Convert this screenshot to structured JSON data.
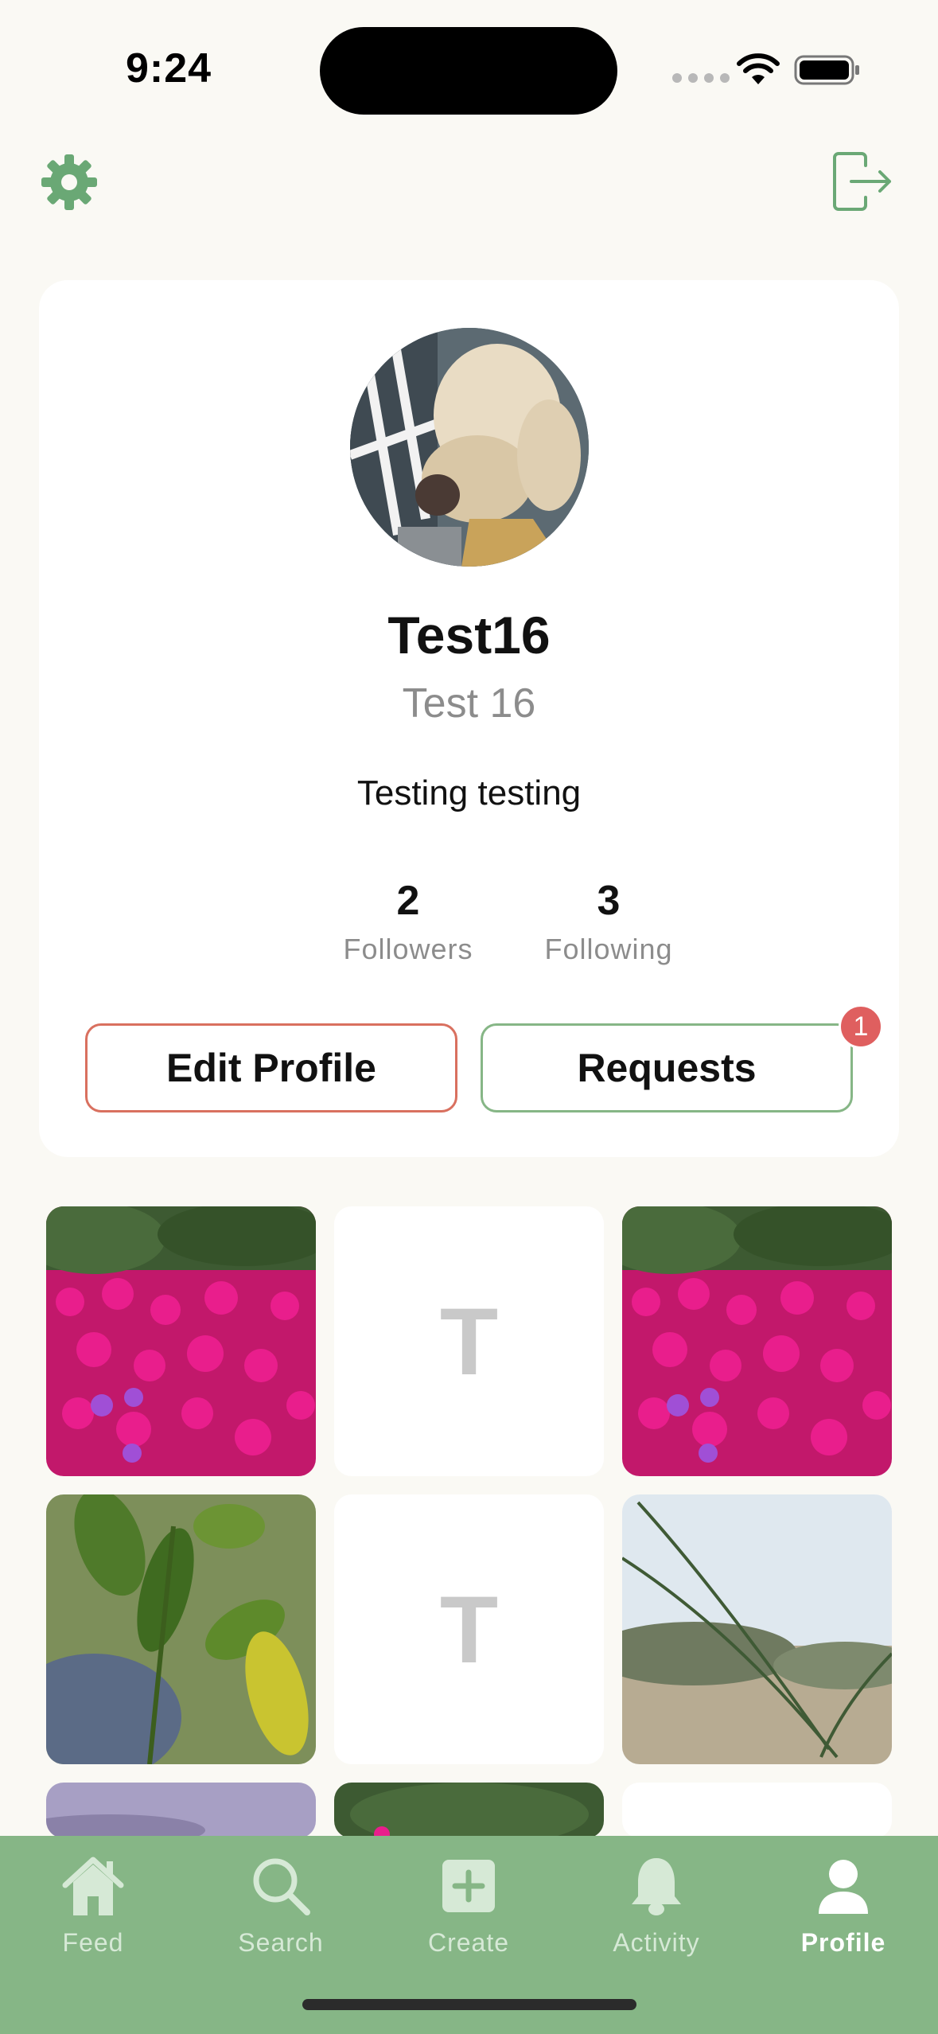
{
  "status_bar": {
    "time": "9:24"
  },
  "profile": {
    "username": "Test16",
    "display_name": "Test 16",
    "bio": "Testing testing",
    "followers_count": "2",
    "followers_label": "Followers",
    "following_count": "3",
    "following_label": "Following",
    "edit_button": "Edit Profile",
    "requests_button": "Requests",
    "requests_badge": "1"
  },
  "grid": {
    "text_post_letter": "T"
  },
  "tab_bar": {
    "items": [
      {
        "label": "Feed",
        "icon": "home-icon"
      },
      {
        "label": "Search",
        "icon": "search-icon"
      },
      {
        "label": "Create",
        "icon": "plus-square-icon"
      },
      {
        "label": "Activity",
        "icon": "bell-icon"
      },
      {
        "label": "Profile",
        "icon": "person-icon"
      }
    ],
    "active": "Profile"
  },
  "colors": {
    "accent_green": "#86b686",
    "accent_red": "#d9705f",
    "badge_red": "#df5f5f",
    "background": "#faf9f4"
  }
}
